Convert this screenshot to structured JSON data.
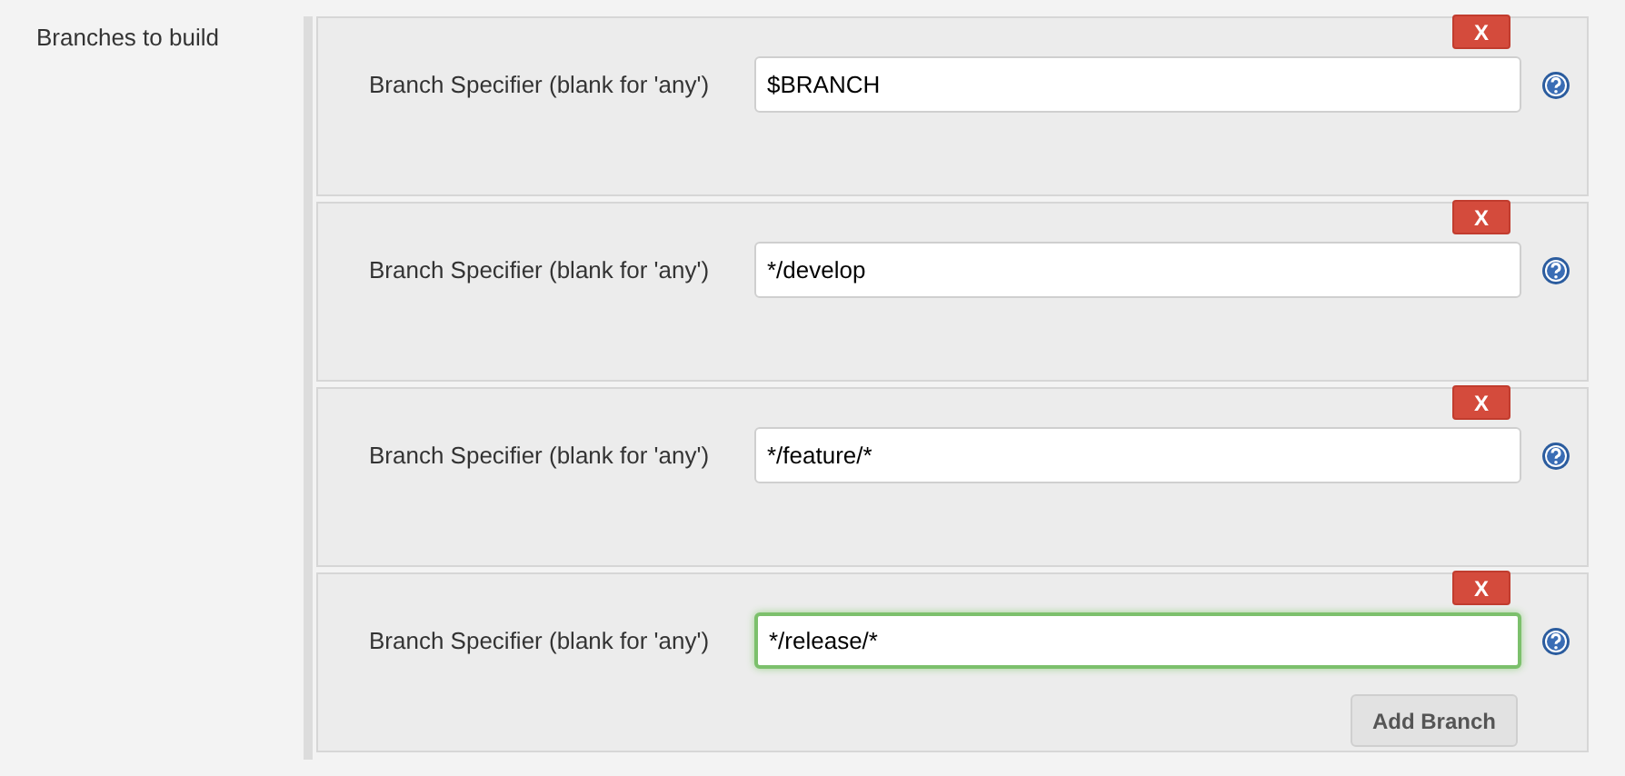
{
  "section_label": "Branches to build",
  "branches": [
    {
      "label": "Branch Specifier (blank for 'any')",
      "value": "$BRANCH",
      "focused": false,
      "delete": "X"
    },
    {
      "label": "Branch Specifier (blank for 'any')",
      "value": "*/develop",
      "focused": false,
      "delete": "X"
    },
    {
      "label": "Branch Specifier (blank for 'any')",
      "value": "*/feature/*",
      "focused": false,
      "delete": "X"
    },
    {
      "label": "Branch Specifier (blank for 'any')",
      "value": "*/release/*",
      "focused": true,
      "delete": "X"
    }
  ],
  "add_button": "Add Branch"
}
